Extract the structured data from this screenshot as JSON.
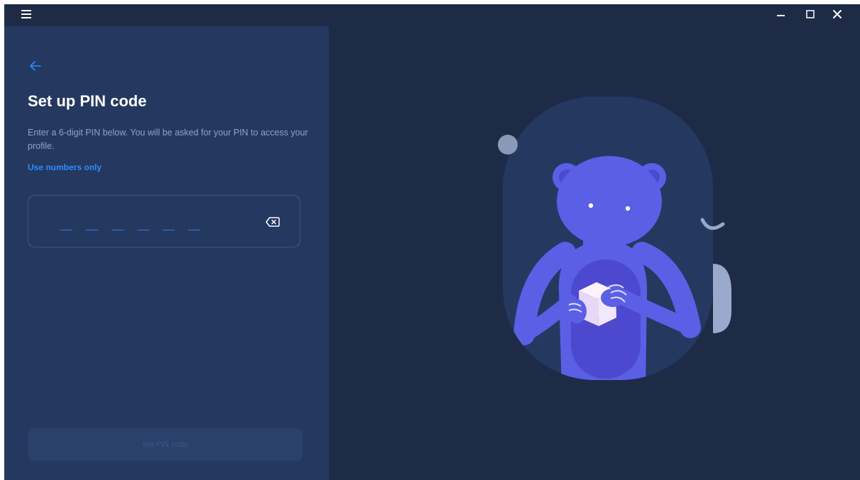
{
  "titlebar": {
    "menu_icon": "hamburger-menu-icon",
    "minimize_icon": "minimize-icon",
    "maximize_icon": "maximize-icon",
    "close_icon": "close-icon"
  },
  "pin_setup": {
    "back_icon": "arrow-left-icon",
    "title": "Set up PIN code",
    "description": "Enter a 6-digit PIN below. You will be asked for your PIN to access your profile.",
    "hint": "Use numbers only",
    "pin_length": 6,
    "backspace_icon": "backspace-icon",
    "submit_label": "Set PIN code"
  },
  "colors": {
    "window_bg": "#1e2b47",
    "panel_bg": "#253860",
    "accent": "#2d8cff",
    "character": "#5b5fe6",
    "disabled_button": "#29416b"
  },
  "illustration": "character-holding-box"
}
